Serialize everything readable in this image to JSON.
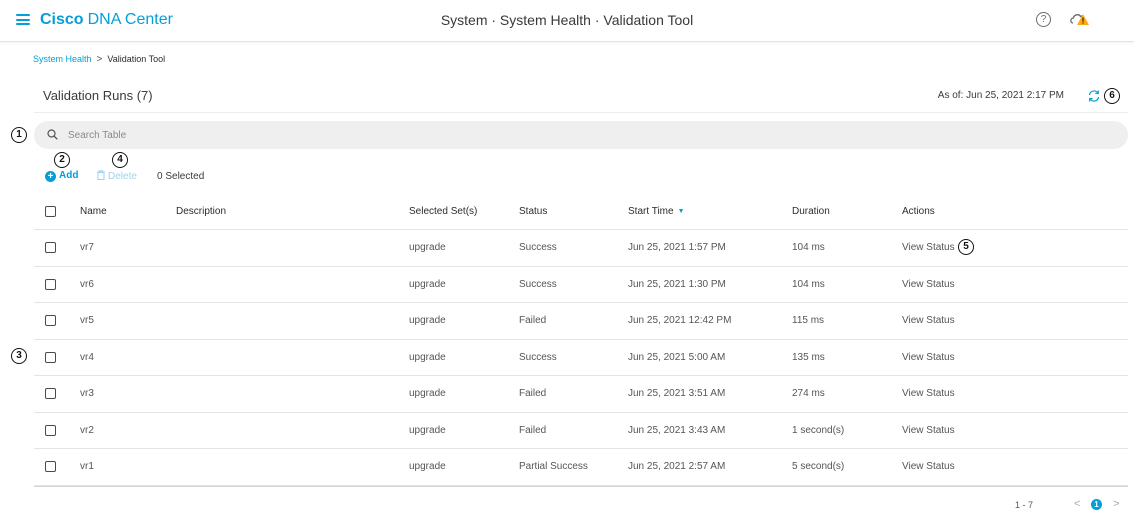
{
  "header": {
    "brand_bold": "Cisco",
    "brand_rest": "DNA Center",
    "title": "System · System Health · Validation Tool",
    "help_glyph": "?"
  },
  "breadcrumb": {
    "parent": "System Health",
    "separator": ">",
    "current": "Validation Tool"
  },
  "section": {
    "title": "Validation Runs (7)",
    "as_of": "As of: Jun 25, 2021 2:17 PM"
  },
  "search": {
    "placeholder": "Search Table",
    "value": ""
  },
  "toolbar": {
    "add_label": "Add",
    "delete_label": "Delete",
    "selected_count": "0 Selected"
  },
  "table": {
    "columns": [
      "Name",
      "Description",
      "Selected Set(s)",
      "Status",
      "Start Time",
      "Duration",
      "Actions"
    ],
    "sort_indicator": "▼",
    "rows": [
      {
        "name": "vr7",
        "description": "",
        "set": "upgrade",
        "status": "Success",
        "start": "Jun 25, 2021 1:57 PM",
        "duration": "104 ms",
        "action": "View Status"
      },
      {
        "name": "vr6",
        "description": "",
        "set": "upgrade",
        "status": "Success",
        "start": "Jun 25, 2021 1:30 PM",
        "duration": "104 ms",
        "action": "View Status"
      },
      {
        "name": "vr5",
        "description": "",
        "set": "upgrade",
        "status": "Failed",
        "start": "Jun 25, 2021 12:42 PM",
        "duration": "115 ms",
        "action": "View Status"
      },
      {
        "name": "vr4",
        "description": "",
        "set": "upgrade",
        "status": "Success",
        "start": "Jun 25, 2021 5:00 AM",
        "duration": "135 ms",
        "action": "View Status"
      },
      {
        "name": "vr3",
        "description": "",
        "set": "upgrade",
        "status": "Failed",
        "start": "Jun 25, 2021 3:51 AM",
        "duration": "274 ms",
        "action": "View Status"
      },
      {
        "name": "vr2",
        "description": "",
        "set": "upgrade",
        "status": "Failed",
        "start": "Jun 25, 2021 3:43 AM",
        "duration": "1 second(s)",
        "action": "View Status"
      },
      {
        "name": "vr1",
        "description": "",
        "set": "upgrade",
        "status": "Partial Success",
        "start": "Jun 25, 2021 2:57 AM",
        "duration": "5 second(s)",
        "action": "View Status"
      }
    ]
  },
  "pagination": {
    "range": "1 - 7",
    "current_page": "1",
    "prev": "<",
    "next": ">"
  },
  "callouts": [
    "1",
    "2",
    "3",
    "4",
    "5",
    "6"
  ],
  "icons": {
    "menu": "hamburger-menu-icon",
    "help": "help-circle-icon",
    "alert": "cloud-warning-icon",
    "refresh": "refresh-icon",
    "search": "search-icon",
    "add": "plus-circle-icon",
    "delete": "trash-icon"
  },
  "colors": {
    "accent": "#049fd9",
    "warning": "#fbab18",
    "text": "#2c2c2c"
  }
}
